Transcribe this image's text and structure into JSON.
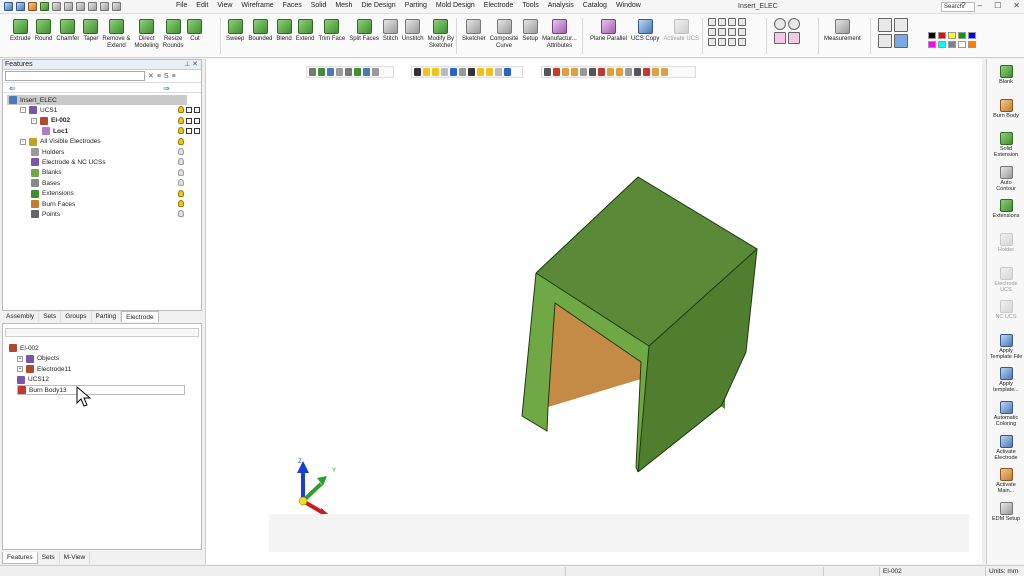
{
  "window": {
    "title": "Insert_ELEC",
    "search_placeholder": "Search",
    "controls": [
      "?",
      "–",
      "☐",
      "✕"
    ]
  },
  "menu": [
    "File",
    "Edit",
    "View",
    "Wireframe",
    "Faces",
    "Solid",
    "Mesh",
    "Die Design",
    "Parting",
    "Mold Design",
    "Electrode",
    "Tools",
    "Analysis",
    "Catalog",
    "Window"
  ],
  "ribbon": {
    "solid_tools": [
      {
        "label": "Extrude",
        "icon": "extrude-icon",
        "style": "green-i"
      },
      {
        "label": "Round",
        "icon": "round-icon",
        "style": "green-i"
      },
      {
        "label": "Chamfer",
        "icon": "chamfer-icon",
        "style": "green-i"
      },
      {
        "label": "Taper",
        "icon": "taper-icon",
        "style": "green-i"
      },
      {
        "label": "Remove &\nExtend",
        "icon": "remove-extend-icon",
        "style": "green-i"
      },
      {
        "label": "Direct\nModeling",
        "icon": "direct-modeling-icon",
        "style": "green-i"
      },
      {
        "label": "Resize\nRounds",
        "icon": "resize-rounds-icon",
        "style": "green-i"
      },
      {
        "label": "Cut",
        "icon": "cut-icon",
        "style": "green-i"
      }
    ],
    "face_tools": [
      {
        "label": "Sweep",
        "icon": "sweep-icon",
        "style": "green-i"
      },
      {
        "label": "Bounded",
        "icon": "bounded-icon",
        "style": "green-i"
      },
      {
        "label": "Blend",
        "icon": "blend-icon",
        "style": "green-i"
      },
      {
        "label": "Extend",
        "icon": "extend-icon",
        "style": "green-i"
      },
      {
        "label": "Trim Face",
        "icon": "trim-face-icon",
        "style": "green-i"
      },
      {
        "label": "Split Faces",
        "icon": "split-faces-icon",
        "style": "green-i"
      },
      {
        "label": "Stitch",
        "icon": "stitch-icon",
        "style": "gray-i"
      },
      {
        "label": "Unstitch",
        "icon": "unstitch-icon",
        "style": "gray-i"
      },
      {
        "label": "Modify By\nSketcher",
        "icon": "modify-by-sketcher-icon",
        "style": "green-i"
      }
    ],
    "sketch_tools": [
      {
        "label": "Sketcher",
        "icon": "sketcher-icon",
        "style": "gray-i"
      },
      {
        "label": "Composite\nCurve",
        "icon": "composite-curve-icon",
        "style": "gray-i"
      },
      {
        "label": "Setup",
        "icon": "setup-icon",
        "style": "gray-i"
      },
      {
        "label": "Manufactur...\nAttributes",
        "icon": "manufacturing-attributes-icon",
        "style": "purple-i"
      }
    ],
    "ucs_tools": [
      {
        "label": "Plane Parallel",
        "icon": "plane-parallel-icon",
        "style": "purple-i",
        "disabled": false
      },
      {
        "label": "UCS Copy",
        "icon": "ucs-copy-icon",
        "style": "blue-i",
        "disabled": false
      },
      {
        "label": "Activate UCS",
        "icon": "activate-ucs-icon",
        "style": "gray-i",
        "disabled": true
      }
    ],
    "measurement": {
      "label": "Measurement",
      "icon": "measurement-icon"
    }
  },
  "features_panel": {
    "title": "Features",
    "tree": [
      {
        "label": "Insert_ELEC",
        "indent": 0,
        "icon": "assembly-icon",
        "bold": false,
        "selected": true,
        "bulb": "",
        "exp": ""
      },
      {
        "label": "UCS1",
        "indent": 1,
        "icon": "ucs-icon",
        "bold": false,
        "selected": false,
        "bulb": "on",
        "exp": "-"
      },
      {
        "label": "El-002",
        "indent": 2,
        "icon": "electrode-icon",
        "bold": true,
        "selected": false,
        "bulb": "on",
        "exp": "-"
      },
      {
        "label": "Loc1",
        "indent": 3,
        "icon": "part-icon",
        "bold": true,
        "selected": false,
        "bulb": "on",
        "exp": ""
      },
      {
        "label": "All Visible Electrodes",
        "indent": 1,
        "icon": "electrode-group-icon",
        "bold": false,
        "selected": false,
        "bulb": "on",
        "exp": "-"
      },
      {
        "label": "Holders",
        "indent": 2,
        "icon": "holder-icon",
        "bold": false,
        "selected": false,
        "bulb": "off",
        "exp": ""
      },
      {
        "label": "Electrode & NC UCSs",
        "indent": 2,
        "icon": "ucs-icon",
        "bold": false,
        "selected": false,
        "bulb": "off",
        "exp": ""
      },
      {
        "label": "Blanks",
        "indent": 2,
        "icon": "blank-icon",
        "bold": false,
        "selected": false,
        "bulb": "off",
        "exp": ""
      },
      {
        "label": "Bases",
        "indent": 2,
        "icon": "base-icon",
        "bold": false,
        "selected": false,
        "bulb": "off",
        "exp": ""
      },
      {
        "label": "Extensions",
        "indent": 2,
        "icon": "extension-icon",
        "bold": false,
        "selected": false,
        "bulb": "on",
        "exp": ""
      },
      {
        "label": "Burn Faces",
        "indent": 2,
        "icon": "burn-face-icon",
        "bold": false,
        "selected": false,
        "bulb": "on",
        "exp": ""
      },
      {
        "label": "Points",
        "indent": 2,
        "icon": "point-icon",
        "bold": false,
        "selected": false,
        "bulb": "off",
        "exp": ""
      }
    ],
    "tabs": [
      "Assembly",
      "Sets",
      "Groups",
      "Parting",
      "Electrode"
    ],
    "active_tab": "Electrode"
  },
  "electrode_panel": {
    "tree": [
      {
        "label": "El-002",
        "indent": 0,
        "icon": "electrode-icon",
        "exp": ""
      },
      {
        "label": "Objects",
        "indent": 1,
        "icon": "objects-icon",
        "exp": "+"
      },
      {
        "label": "Electrode11",
        "indent": 1,
        "icon": "electrode-icon",
        "exp": "+"
      },
      {
        "label": "UCS12",
        "indent": 1,
        "icon": "ucs-icon",
        "exp": ""
      },
      {
        "label": "Burn Body13",
        "indent": 1,
        "icon": "burn-body-icon",
        "exp": "",
        "boxed": true
      }
    ]
  },
  "bottom_tabs": [
    "Features",
    "Sets",
    "M-View"
  ],
  "right_toolbar": [
    {
      "label": "Blank",
      "icon": "blank-icon",
      "style": "green-i",
      "disabled": false
    },
    {
      "label": "Burn Body",
      "icon": "burn-body-icon",
      "style": "orange-i",
      "disabled": false
    },
    {
      "label": "Solid\nExtension",
      "icon": "solid-extension-icon",
      "style": "green-i",
      "disabled": false
    },
    {
      "label": "Auto\nContour",
      "icon": "auto-contour-icon",
      "style": "gray-i",
      "disabled": false
    },
    {
      "label": "Extensions",
      "icon": "extensions-icon",
      "style": "green-i",
      "disabled": false
    },
    {
      "label": "Holder",
      "icon": "holder-icon",
      "style": "gray-i",
      "disabled": true
    },
    {
      "label": "Electrode\nUCS",
      "icon": "electrode-ucs-icon",
      "style": "gray-i",
      "disabled": true
    },
    {
      "label": "NC UCS",
      "icon": "nc-ucs-icon",
      "style": "gray-i",
      "disabled": true
    },
    {
      "label": "Apply\nTemplate File",
      "icon": "apply-template-file-icon",
      "style": "blue-i",
      "disabled": false
    },
    {
      "label": "Apply\ntemplate...",
      "icon": "apply-template-icon",
      "style": "blue-i",
      "disabled": false
    },
    {
      "label": "Automatic\nColoring",
      "icon": "automatic-coloring-icon",
      "style": "blue-i",
      "disabled": false
    },
    {
      "label": "Activate\nElectrode",
      "icon": "activate-electrode-icon",
      "style": "blue-i",
      "disabled": false
    },
    {
      "label": "Activate\nMain...",
      "icon": "activate-main-icon",
      "style": "orange-i",
      "disabled": false
    },
    {
      "label": "EDM Setup",
      "icon": "edm-setup-icon",
      "style": "gray-i",
      "disabled": false
    }
  ],
  "triad": {
    "x": "X",
    "y": "Y",
    "z": "Z"
  },
  "status": {
    "active": "El-002",
    "units": "Units: mm"
  },
  "colors": {
    "model_face_top": "#5a8a38",
    "model_face_front": "#6fa844",
    "model_face_right": "#4f7e2e",
    "model_inner": "#c48a46",
    "accent": "#2a62c9"
  }
}
